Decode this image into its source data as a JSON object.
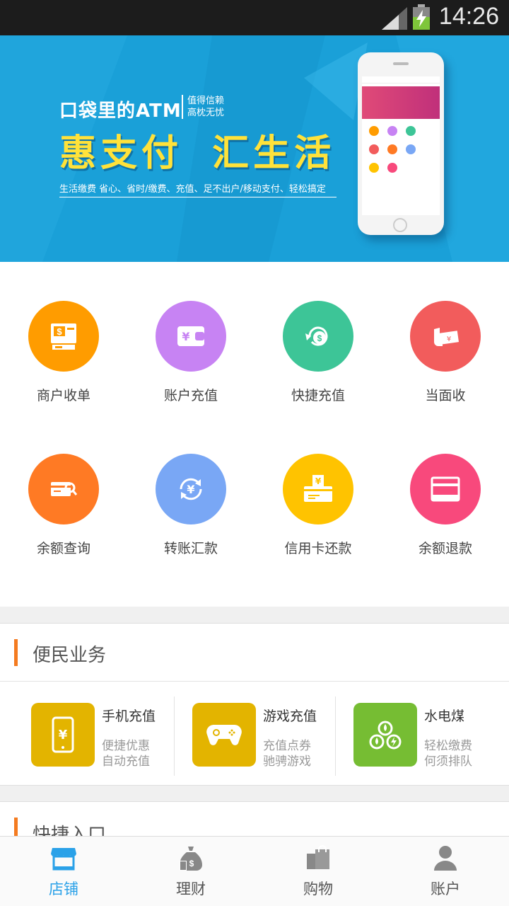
{
  "status_bar": {
    "time": "14:26"
  },
  "banner": {
    "atm_title": "口袋里的ATM",
    "atm_side_line1": "值得信赖",
    "atm_side_line2": "高枕无忧",
    "big_title_left": "惠支付",
    "big_title_right": "汇生活",
    "tagline": "生活缴费 省心、省时/缴费、充值、足不出户/移动支付、轻松搞定"
  },
  "grid": [
    {
      "label": "商户收单",
      "icon": "merchant-icon",
      "color": "#ff9c00"
    },
    {
      "label": "账户充值",
      "icon": "wallet-icon",
      "color": "#c783f3"
    },
    {
      "label": "快捷充值",
      "icon": "money-bag-icon",
      "color": "#3dc597"
    },
    {
      "label": "当面收",
      "icon": "hand-money-icon",
      "color": "#f25c5c"
    },
    {
      "label": "余额查询",
      "icon": "card-search-icon",
      "color": "#ff7a24"
    },
    {
      "label": "转账汇款",
      "icon": "transfer-icon",
      "color": "#79a7f5"
    },
    {
      "label": "信用卡还款",
      "icon": "credit-card-icon",
      "color": "#ffc300"
    },
    {
      "label": "余额退款",
      "icon": "refund-card-icon",
      "color": "#f8497c"
    }
  ],
  "services_section": {
    "title": "便民业务",
    "items": [
      {
        "name": "手机充值",
        "desc1": "便捷优惠",
        "desc2": "自动充值",
        "icon": "mobile-icon",
        "color": "#e3b400"
      },
      {
        "name": "游戏充值",
        "desc1": "充值点券",
        "desc2": "驰骋游戏",
        "icon": "gamepad-icon",
        "color": "#e3b400"
      },
      {
        "name": "水电煤",
        "desc1": "轻松缴费",
        "desc2": "何须排队",
        "icon": "utilities-icon",
        "color": "#76bd33"
      }
    ]
  },
  "quick_section": {
    "title": "快捷入口"
  },
  "bottom_nav": [
    {
      "label": "店铺",
      "icon": "store-icon",
      "active": true
    },
    {
      "label": "理财",
      "icon": "finance-icon",
      "active": false
    },
    {
      "label": "购物",
      "icon": "shopping-icon",
      "active": false
    },
    {
      "label": "账户",
      "icon": "user-icon",
      "active": false
    }
  ],
  "colors": {
    "accent": "#2aa1e8",
    "section_bar": "#f47b20",
    "banner_bg": "#1aa0d8",
    "banner_title": "#ffe23a"
  }
}
